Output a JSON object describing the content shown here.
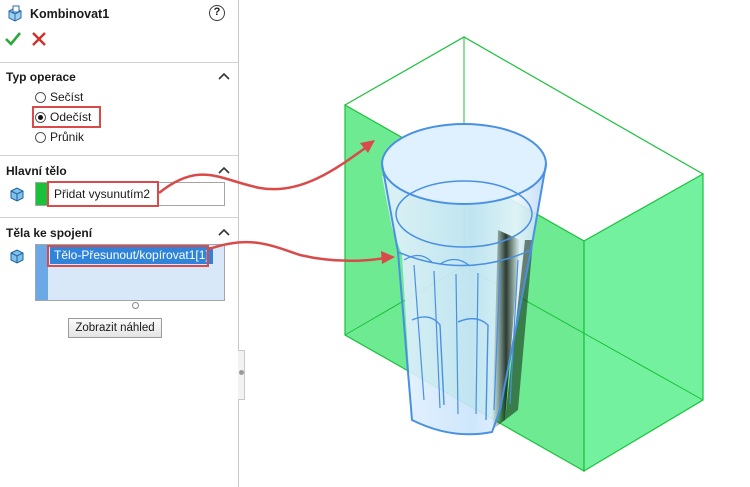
{
  "panel": {
    "title": "Kombinovat1",
    "help_label": "?",
    "ok_icon": "check-icon",
    "cancel_icon": "cross-icon"
  },
  "operation_section": {
    "title": "Typ operace",
    "options": [
      {
        "label": "Sečíst",
        "checked": false
      },
      {
        "label": "Odečíst",
        "checked": true
      },
      {
        "label": "Průnik",
        "checked": false
      }
    ]
  },
  "main_body_section": {
    "title": "Hlavní tělo",
    "value": "Přidat vysunutím2",
    "swatch_color": "#19c23a"
  },
  "join_bodies_section": {
    "title": "Těla ke spojení",
    "items": [
      "Tělo-Přesunout/kopírovat1[1]"
    ]
  },
  "preview_button": "Zobrazit náhled",
  "colors": {
    "highlight_red": "#d94a4a",
    "box_green": "#19c23a",
    "glass_blue": "#4a90e2",
    "selection_blue": "#2f83d8"
  }
}
